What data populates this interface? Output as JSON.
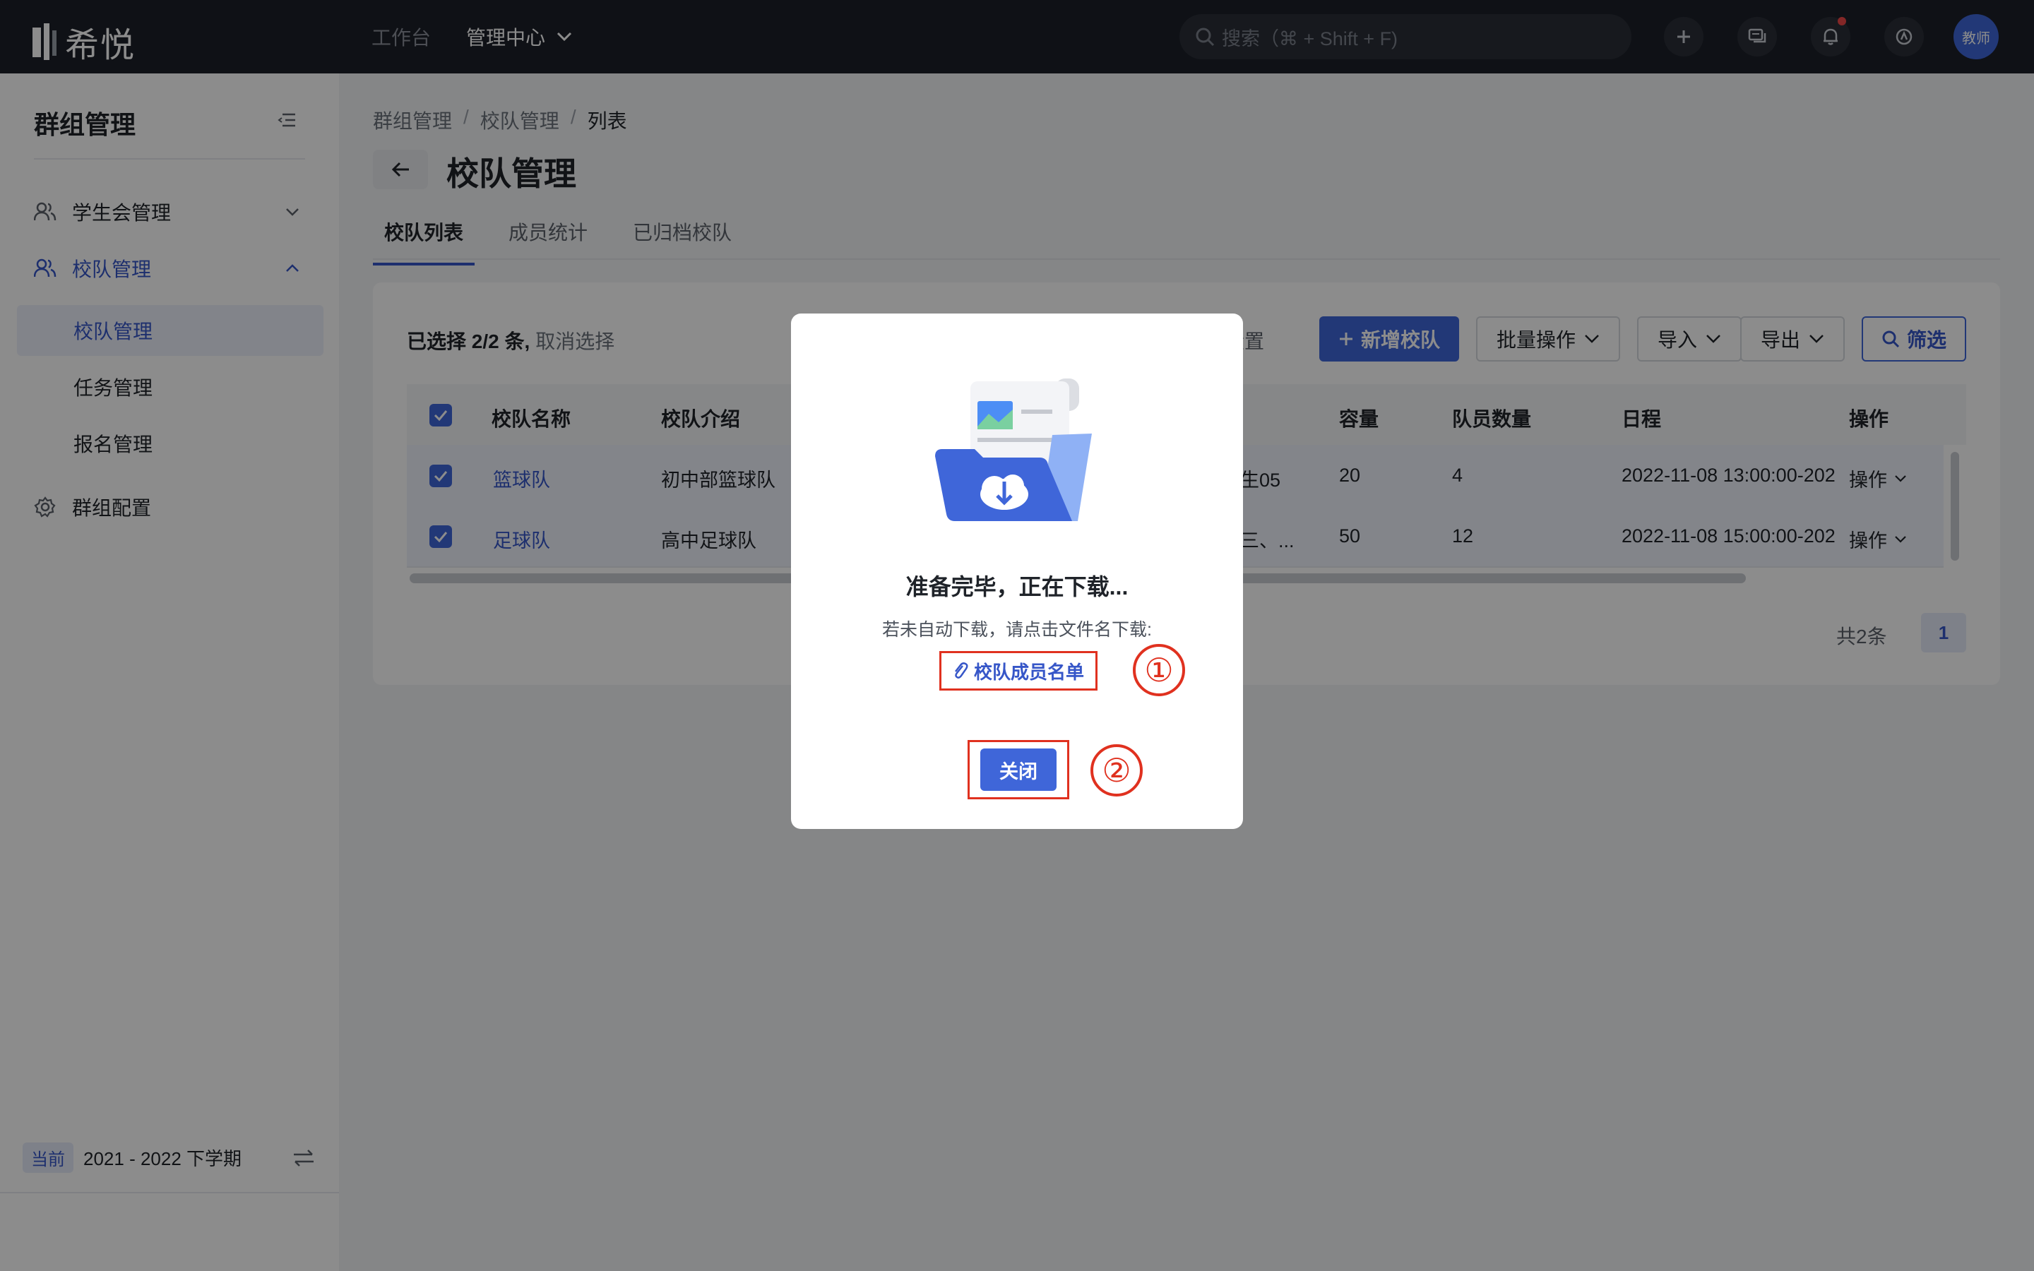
{
  "app": {
    "logo_text": "希悦"
  },
  "topnav": {
    "items": [
      {
        "label": "工作台"
      },
      {
        "label": "管理中心"
      }
    ]
  },
  "search": {
    "placeholder": "搜索（⌘ + Shift + F)"
  },
  "user": {
    "avatar_text": "教师"
  },
  "sidebar": {
    "title": "群组管理",
    "groups": [
      {
        "label": "学生会管理",
        "expanded": false
      },
      {
        "label": "校队管理",
        "expanded": true,
        "items": [
          {
            "label": "校队管理",
            "selected": true
          },
          {
            "label": "任务管理"
          },
          {
            "label": "报名管理"
          }
        ]
      },
      {
        "label": "群组配置"
      }
    ],
    "footer": {
      "tag": "当前",
      "term": "2021 - 2022 下学期"
    }
  },
  "breadcrumb": [
    "群组管理",
    "校队管理",
    "列表"
  ],
  "page": {
    "title": "校队管理"
  },
  "tabs": [
    {
      "label": "校队列表",
      "active": true
    },
    {
      "label": "成员统计"
    },
    {
      "label": "已归档校队"
    }
  ],
  "toolbar": {
    "selection": {
      "count_text": "已选择 2/2 条,",
      "cancel": "取消选择"
    },
    "settings_partial": "设置",
    "add_label": "新增校队",
    "batch_label": "批量操作",
    "import_label": "导入",
    "export_label": "导出",
    "filter_label": "筛选"
  },
  "table": {
    "columns": [
      "校队名称",
      "校队介绍",
      "容量",
      "队员数量",
      "日程",
      "操作"
    ],
    "rows": [
      {
        "name": "篮球队",
        "intro": "初中部篮球队",
        "partial": "生05",
        "capacity": "20",
        "members": "4",
        "schedule": "2022-11-08 13:00:00-202",
        "op": "操作",
        "checked": true
      },
      {
        "name": "足球队",
        "intro": "高中足球队",
        "partial": "三、...",
        "capacity": "50",
        "members": "12",
        "schedule": "2022-11-08 15:00:00-202",
        "op": "操作",
        "checked": true
      }
    ]
  },
  "pagination": {
    "total_text": "共2条",
    "current": "1"
  },
  "modal": {
    "title": "准备完毕，正在下载...",
    "description": "若未自动下载，请点击文件名下载:",
    "file_link": "校队成员名单",
    "close_label": "关闭",
    "markers": [
      "①",
      "②"
    ]
  },
  "colors": {
    "accent": "#3f66d9",
    "topbar": "#1c2028",
    "annotation_red": "#e0311f"
  }
}
